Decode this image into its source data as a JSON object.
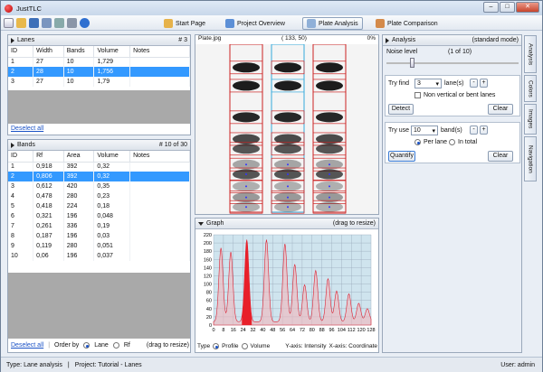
{
  "window": {
    "title": "JustTLC"
  },
  "nav": {
    "start": "Start Page",
    "overview": "Project Overview",
    "plate": "Plate Analysis",
    "comparison": "Plate Comparison"
  },
  "lanes": {
    "title": "Lanes",
    "count": "# 3",
    "headers": [
      "ID",
      "Width",
      "Bands",
      "Volume",
      "Notes"
    ],
    "rows": [
      [
        "1",
        "27",
        "10",
        "1,729",
        ""
      ],
      [
        "2",
        "28",
        "10",
        "1,756",
        ""
      ],
      [
        "3",
        "27",
        "10",
        "1,79",
        ""
      ]
    ],
    "deselect": "Deselect all"
  },
  "bands": {
    "title": "Bands",
    "count": "# 10 of 30",
    "headers": [
      "ID",
      "Rf",
      "Area",
      "Volume",
      "Notes"
    ],
    "rows": [
      [
        "1",
        "0,918",
        "392",
        "0,32",
        ""
      ],
      [
        "2",
        "0,806",
        "392",
        "0,32",
        ""
      ],
      [
        "3",
        "0,612",
        "420",
        "0,35",
        ""
      ],
      [
        "4",
        "0,478",
        "280",
        "0,23",
        ""
      ],
      [
        "5",
        "0,418",
        "224",
        "0,18",
        ""
      ],
      [
        "6",
        "0,321",
        "196",
        "0,048",
        ""
      ],
      [
        "7",
        "0,261",
        "336",
        "0,19",
        ""
      ],
      [
        "8",
        "0,187",
        "196",
        "0,03",
        ""
      ],
      [
        "9",
        "0,119",
        "280",
        "0,051",
        ""
      ],
      [
        "10",
        "0,06",
        "196",
        "0,037",
        ""
      ]
    ],
    "deselect": "Deselect all",
    "orderby": "Order by",
    "lane": "Lane",
    "rf": "Rf",
    "drag": "(drag to resize)"
  },
  "plate": {
    "title": "Plate.jpg",
    "coords": "( 133, 50)",
    "pct": "0%"
  },
  "graph": {
    "title": "Graph",
    "drag": "(drag to resize)",
    "type_label": "Type",
    "profile": "Profile",
    "volume": "Volume",
    "yaxis": "Y-axis: Intensity",
    "xaxis": "X-axis: Coordinate",
    "yticks": [
      "220",
      "200",
      "180",
      "160",
      "140",
      "120",
      "100",
      "80",
      "60",
      "40",
      "20",
      "0"
    ],
    "xticks": [
      "0",
      "8",
      "16",
      "24",
      "32",
      "40",
      "48",
      "56",
      "64",
      "72",
      "80",
      "88",
      "96",
      "104",
      "112",
      "120",
      "128"
    ]
  },
  "analysis": {
    "title": "Analysis",
    "mode": "(standard mode)",
    "noise": "Noise level",
    "noise_val": "(1 of 10)",
    "tryfind": "Try find",
    "lanes_count": "3",
    "lanes_unit": "lane(s)",
    "nonvert": "Non vertical or bent lanes",
    "detect": "Detect",
    "clear": "Clear",
    "tryuse": "Try use",
    "bands_count": "10",
    "bands_unit": "band(s)",
    "perlane": "Per lane",
    "intotal": "In total",
    "quantify": "Quantify",
    "clear2": "Clear",
    "minus": "-",
    "plus": "+"
  },
  "sidetabs": {
    "analysis": "Analysis",
    "colors": "Colors",
    "images": "Images",
    "navigation": "Navigation"
  },
  "status": {
    "type": "Type:  Lane analysis",
    "sep": "|",
    "project": "Project:  Tutorial - Lanes",
    "user": "User:  admin"
  },
  "colors": {
    "accent": "#3399ff",
    "lane": "#cc2222",
    "peak": "#e8202a"
  }
}
